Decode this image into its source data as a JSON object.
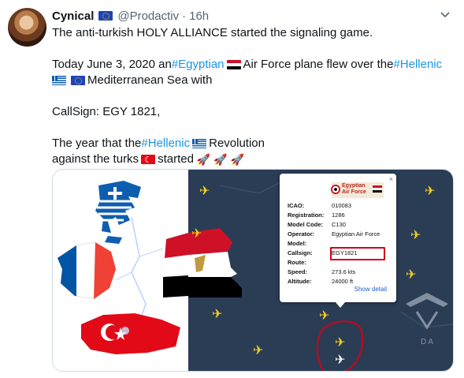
{
  "tweet": {
    "author": {
      "name": "Cynical",
      "handle": "@Prodactiv",
      "separator": "·",
      "time": "16h",
      "name_flag": "eu-flag"
    },
    "menu_icon": "chevron-down-icon",
    "lines": {
      "l1": "The anti-turkish HOLY ALLIANCE started the signaling game.",
      "l2a": "Today June 3, 2020 an ",
      "l2_tag": "#Egyptian",
      "l2b": " Air Force plane flew over the ",
      "l2_tag2": "#Hellenic",
      "l3": " Mediterranean Sea with",
      "l4": "CallSign: EGY 1821,",
      "l5a": "The year that the ",
      "l5_tag": "#Hellenic",
      "l5b": " Revolution",
      "l6a": "against the turks",
      "l6b": " started"
    },
    "media": {
      "popup": {
        "logo_text": "Egyptian Air Force",
        "rows": [
          {
            "key": "ICAO:",
            "value": "010083"
          },
          {
            "key": "Registration:",
            "value": "1286"
          },
          {
            "key": "Model Code:",
            "value": "C130"
          },
          {
            "key": "Operator:",
            "value": "Egyptian Air Force"
          },
          {
            "key": "Model:",
            "value": ""
          },
          {
            "key": "Callsign:",
            "value": "EGY1821"
          },
          {
            "key": "Route:",
            "value": ""
          },
          {
            "key": "Speed:",
            "value": "273.6 kts"
          },
          {
            "key": "Altitude:",
            "value": "24000 ft"
          }
        ],
        "show_detail": "Show detail",
        "close": "×"
      },
      "watermark_text": "D A"
    }
  },
  "colors": {
    "hashtag": "#1b95e0",
    "secondary_text": "#536471",
    "map_background": "#2b3d55",
    "plane": "#f5d020",
    "highlight": "#d0021b"
  }
}
